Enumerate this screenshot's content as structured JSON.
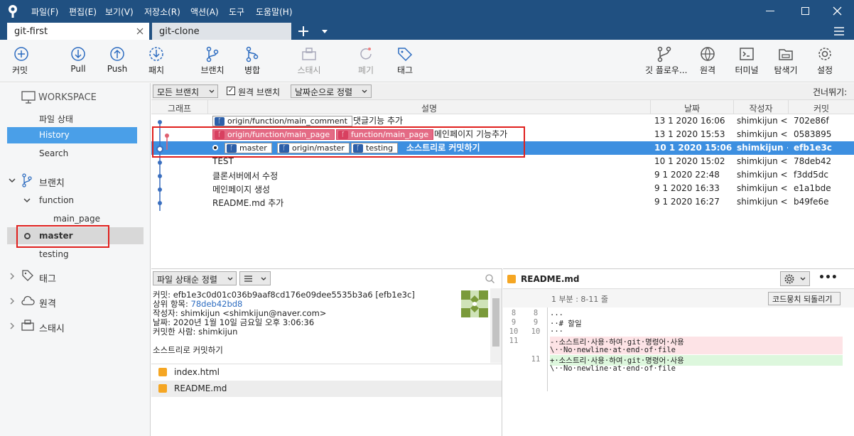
{
  "menu": [
    "파일(F)",
    "편집(E)",
    "보기(V)",
    "저장소(R)",
    "액션(A)",
    "도구",
    "도움말(H)"
  ],
  "tabs": {
    "active": "git-first",
    "other": "git-clone"
  },
  "toolbar": {
    "commit": "커밋",
    "pull": "Pull",
    "push": "Push",
    "fetch": "패치",
    "branch": "브랜치",
    "merge": "병합",
    "stash": "스태시",
    "discard": "폐기",
    "tag": "태그",
    "gitflow": "깃 플로우...",
    "remote": "원격",
    "terminal": "터미널",
    "explorer": "탐색기",
    "settings": "설정"
  },
  "sidebar": {
    "workspace": "WORKSPACE",
    "file_status": "파일 상태",
    "history": "History",
    "search": "Search",
    "branches": "브랜치",
    "function": "function",
    "main_page": "main_page",
    "master": "master",
    "testing": "testing",
    "tags": "태그",
    "remotes": "원격",
    "stashes": "스태시"
  },
  "filter": {
    "branches": "모든 브랜치",
    "remote_branch": "원격 브랜치",
    "sort": "날짜순으로 정렬",
    "jump": "건너뛰기:"
  },
  "columns": {
    "graph": "그래프",
    "desc": "설명",
    "date": "날짜",
    "author": "작성자",
    "commit": "커밋"
  },
  "commits": [
    {
      "badges": [
        {
          "t": "origin/function/main_comment",
          "c": "blue"
        }
      ],
      "msg": "댓글기능 추가",
      "date": "13 1 2020 16:06",
      "author": "shimkijun <shimki",
      "hash": "702e86f"
    },
    {
      "badges": [
        {
          "t": "origin/function/main_page",
          "c": "pink"
        },
        {
          "t": "function/main_page",
          "c": "pink"
        }
      ],
      "msg": "메인페이지 기능추가",
      "date": "13 1 2020 15:53",
      "author": "shimkijun <shimki",
      "hash": "0583895"
    },
    {
      "badges": [
        {
          "t": "master",
          "c": "blue"
        },
        {
          "t": "origin/master",
          "c": "blue"
        },
        {
          "t": "testing",
          "c": "blue"
        }
      ],
      "msg": "소스트리로 커밋하기",
      "date": "10 1 2020 15:06",
      "author": "shimkijun <shimk",
      "hash": "efb1e3c"
    },
    {
      "badges": [],
      "msg": "TEST",
      "date": "10 1 2020 15:02",
      "author": "shimkijun <shimki",
      "hash": "78deb42"
    },
    {
      "badges": [],
      "msg": "클론서버에서 수정",
      "date": "9 1 2020 22:48",
      "author": "shimkijun <shimki",
      "hash": "f3dd5dc"
    },
    {
      "badges": [],
      "msg": "메인페이지 생성",
      "date": "9 1 2020 16:33",
      "author": "shimkijun <shimki",
      "hash": "e1a1bde"
    },
    {
      "badges": [],
      "msg": "README.md 추가",
      "date": "9 1 2020 16:27",
      "author": "shimkijun <shimki",
      "hash": "b49fe6e"
    }
  ],
  "details": {
    "sort": "파일 상태순 정렬",
    "commit_line": "커밋: efb1e3c0d01c036b9aaf8cd176e09dee5535b3a6 [efb1e3c]",
    "parent_label": "상위 항목:",
    "parent": "78deb42bd8",
    "author_line": "작성자: shimkijun <shimkijun@naver.com>",
    "date_line": "날짜: 2020년 1월 10일 금요일 오후 3:06:36",
    "committer_line": "커밋한 사람: shimkijun",
    "message": "소스트리로 커밋하기",
    "files": [
      "index.html",
      "README.md"
    ]
  },
  "diff": {
    "file": "README.md",
    "hunk": "1 부분 : 8-11 줄",
    "revert": "코드뭉치 되돌리기",
    "lines": [
      {
        "a": "8",
        "b": "8",
        "t": "...",
        "k": "ctx"
      },
      {
        "a": "9",
        "b": "9",
        "t": "··# 할일",
        "k": "ctx"
      },
      {
        "a": "10",
        "b": "10",
        "t": "···",
        "k": "ctx"
      },
      {
        "a": "11",
        "b": "",
        "t": "-·소스트리·사용·하여·git·명령어·사용",
        "k": "del"
      },
      {
        "a": "",
        "b": "",
        "t": "\\··No·newline·at·end·of·file",
        "k": "del"
      },
      {
        "a": "",
        "b": "11",
        "t": "+·소스트리·사용·하여·git·명령어·사용",
        "k": "add"
      },
      {
        "a": "",
        "b": "",
        "t": "\\··No·newline·at·end·of·file",
        "k": "ctx"
      }
    ]
  }
}
